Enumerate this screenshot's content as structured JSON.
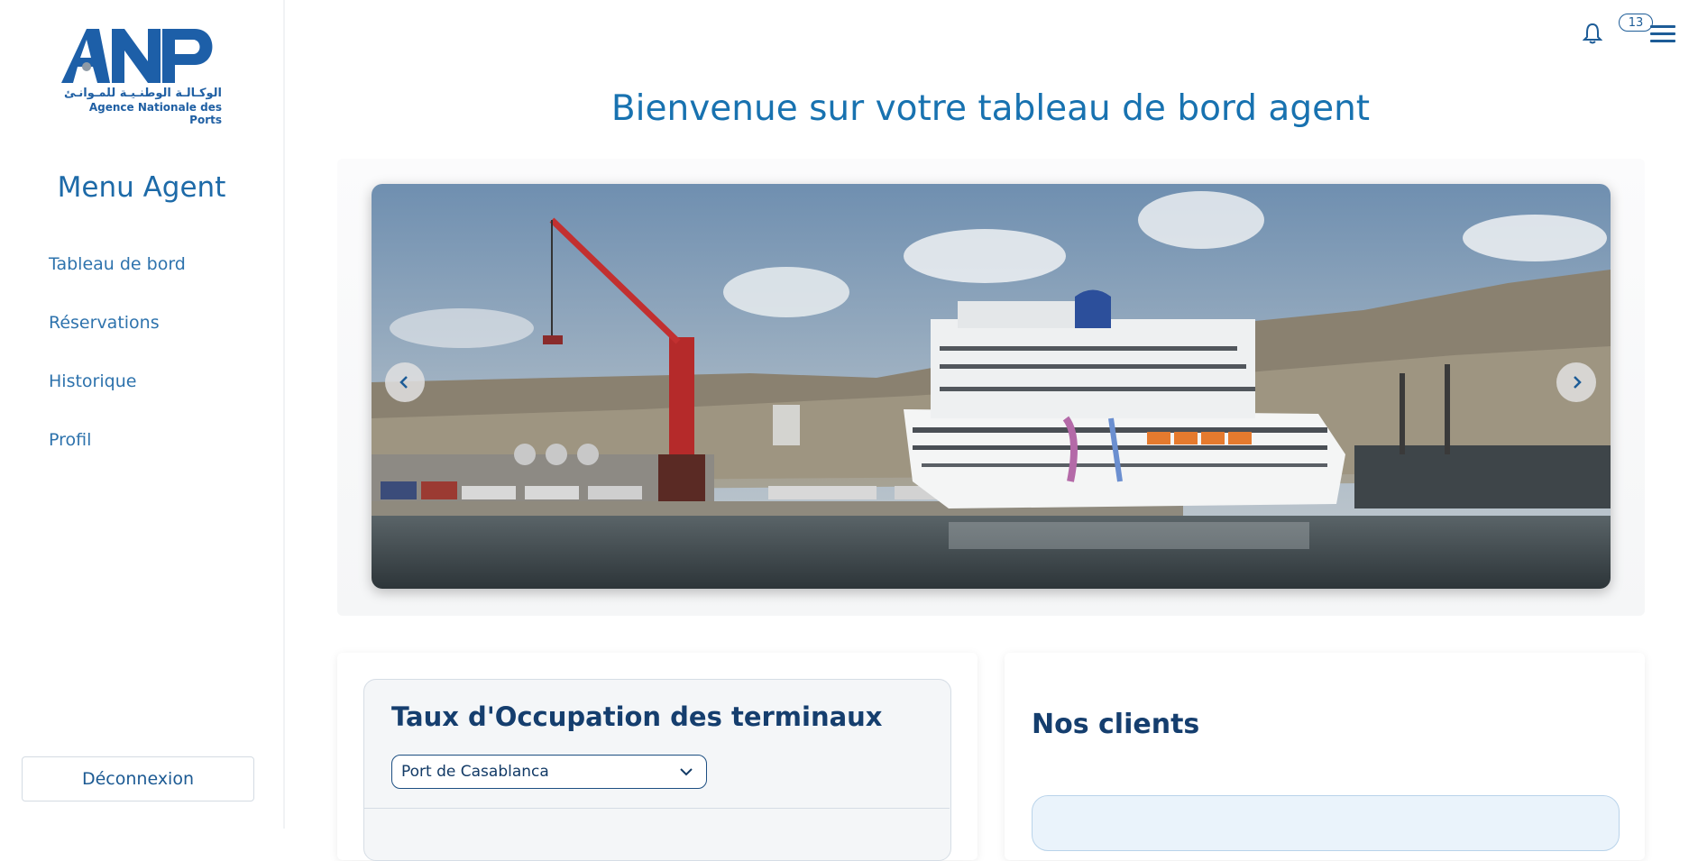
{
  "sidebar": {
    "logo_text": "ANP",
    "logo_arabic": "الوكـالـة الوطنـيـة للمـوانـئ",
    "logo_subtitle": "Agence Nationale des Ports",
    "menu_title": "Menu Agent",
    "items": [
      {
        "label": "Tableau de bord"
      },
      {
        "label": "Réservations"
      },
      {
        "label": "Historique"
      },
      {
        "label": "Profil"
      }
    ],
    "logout_label": "Déconnexion"
  },
  "header": {
    "notification_count": "13",
    "icons": [
      "bell-icon",
      "menu-icon"
    ]
  },
  "main": {
    "title": "Bienvenue sur votre tableau de bord agent",
    "carousel": {
      "prev_icon": "chevron-left-icon",
      "next_icon": "chevron-right-icon"
    },
    "occupation": {
      "title": "Taux d'Occupation des terminaux",
      "selected_port": "Port de Casablanca"
    },
    "clients": {
      "title": "Nos clients"
    }
  },
  "colors": {
    "primary": "#1872b0",
    "dark_blue": "#153e6e",
    "sidebar_link": "#2e73ad"
  }
}
